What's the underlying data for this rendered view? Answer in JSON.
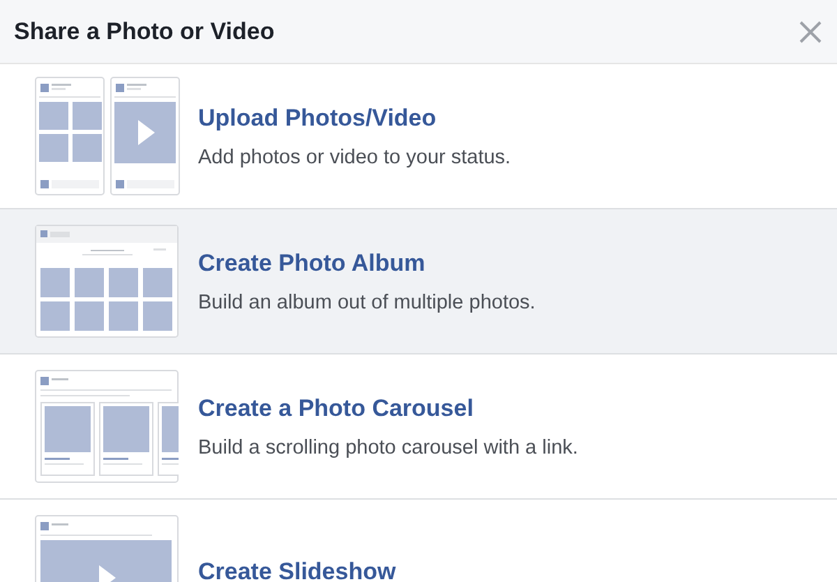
{
  "dialog": {
    "title": "Share a Photo or Video"
  },
  "options": [
    {
      "kind": "upload",
      "title": "Upload Photos/Video",
      "description": "Add photos or video to your status.",
      "selected": false
    },
    {
      "kind": "album",
      "title": "Create Photo Album",
      "description": "Build an album out of multiple photos.",
      "selected": true
    },
    {
      "kind": "carousel",
      "title": "Create a Photo Carousel",
      "description": "Build a scrolling photo carousel with a link.",
      "selected": false
    },
    {
      "kind": "slideshow",
      "title": "Create Slideshow",
      "selected": false
    }
  ]
}
